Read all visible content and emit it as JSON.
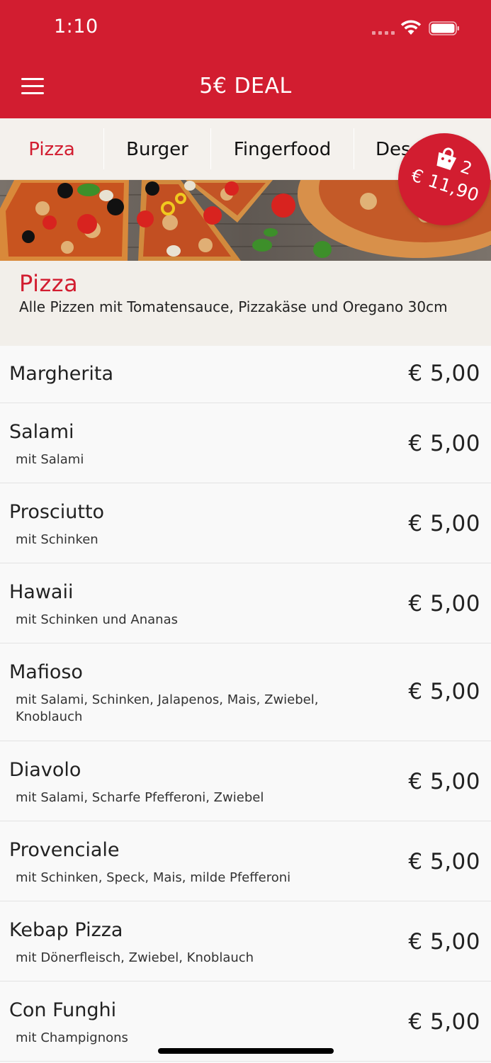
{
  "status_bar": {
    "time": "1:10"
  },
  "nav": {
    "title": "5€ DEAL",
    "menu_icon": "hamburger-menu-icon"
  },
  "tabs": [
    {
      "label": "Pizza",
      "active": true
    },
    {
      "label": "Burger",
      "active": false
    },
    {
      "label": "Fingerfood",
      "active": false
    },
    {
      "label": "Desserts",
      "active": false
    }
  ],
  "cart": {
    "count": "2",
    "total": "€ 11,90",
    "icon": "shopping-bag-icon"
  },
  "section": {
    "title": "Pizza",
    "description": "Alle Pizzen mit Tomatensauce, Pizzakäse und Oregano 30cm"
  },
  "items": [
    {
      "name": "Margherita",
      "desc": "",
      "price": "€ 5,00"
    },
    {
      "name": "Salami",
      "desc": "mit Salami",
      "price": "€ 5,00"
    },
    {
      "name": "Prosciutto",
      "desc": "mit Schinken",
      "price": "€ 5,00"
    },
    {
      "name": "Hawaii",
      "desc": "mit Schinken und Ananas",
      "price": "€ 5,00"
    },
    {
      "name": "Mafioso",
      "desc": "mit Salami, Schinken, Jalapenos, Mais, Zwiebel, Knoblauch",
      "price": "€ 5,00"
    },
    {
      "name": "Diavolo",
      "desc": "mit Salami, Scharfe Pfefferoni, Zwiebel",
      "price": "€ 5,00"
    },
    {
      "name": "Provenciale",
      "desc": "mit Schinken, Speck, Mais, milde Pfefferoni",
      "price": "€ 5,00"
    },
    {
      "name": "Kebap Pizza",
      "desc": "mit Dönerfleisch, Zwiebel, Knoblauch",
      "price": "€ 5,00"
    },
    {
      "name": "Con Funghi",
      "desc": "mit Champignons",
      "price": "€ 5,00"
    }
  ],
  "colors": {
    "brand_red": "#d21d30",
    "header_bg": "#f2efea",
    "tabs_bg": "#f4f1ed"
  }
}
